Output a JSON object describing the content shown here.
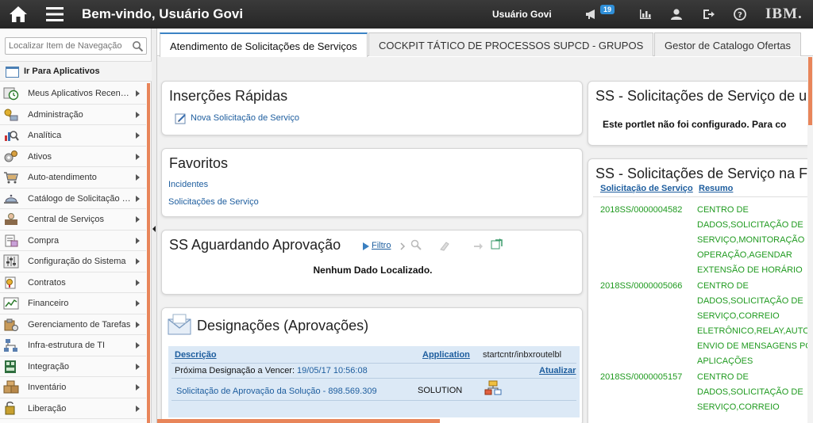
{
  "topbar": {
    "welcome": "Bem-vindo, Usuário Govi",
    "user": "Usuário Govi",
    "notifications_count": "19",
    "brand": "IBM.",
    "icons": [
      "home-icon",
      "menu-icon",
      "megaphone-icon",
      "bar-chart-icon",
      "user-icon",
      "logout-icon",
      "help-icon"
    ]
  },
  "sidebar": {
    "search_placeholder": "Localizar Item de Navegação",
    "goto_label": "Ir Para Aplicativos",
    "items": [
      {
        "label": "Meus Aplicativos Recen…",
        "icon": "clock-icon"
      },
      {
        "label": "Administração",
        "icon": "key-icon"
      },
      {
        "label": "Analítica",
        "icon": "analytics-icon"
      },
      {
        "label": "Ativos",
        "icon": "gears-icon"
      },
      {
        "label": "Auto-atendimento",
        "icon": "cart-icon"
      },
      {
        "label": "Catálogo de Solicitação …",
        "icon": "service-bell-icon"
      },
      {
        "label": "Central de Serviços",
        "icon": "helpdesk-icon"
      },
      {
        "label": "Compra",
        "icon": "purchase-icon"
      },
      {
        "label": "Configuração do Sistema",
        "icon": "sliders-icon"
      },
      {
        "label": "Contratos",
        "icon": "contract-icon"
      },
      {
        "label": "Financeiro",
        "icon": "finance-chart-icon"
      },
      {
        "label": "Gerenciamento de Tarefas",
        "icon": "task-icon"
      },
      {
        "label": "Infra-estrutura de TI",
        "icon": "network-icon"
      },
      {
        "label": "Integração",
        "icon": "integration-icon"
      },
      {
        "label": "Inventário",
        "icon": "inventory-icon"
      },
      {
        "label": "Liberação",
        "icon": "release-icon"
      }
    ]
  },
  "tabs": [
    {
      "label": "Atendimento de Solicitações de Serviços",
      "active": true
    },
    {
      "label": "COCKPIT TÁTICO DE PROCESSOS SUPCD - GRUPOS",
      "active": false
    },
    {
      "label": "Gestor de Catalogo Ofertas",
      "active": false
    }
  ],
  "insercoes": {
    "title": "Inserções Rápidas",
    "link": "Nova Solicitação de Serviço"
  },
  "favoritos": {
    "title": "Favoritos",
    "links": [
      "Incidentes",
      "Solicitações de Serviço"
    ]
  },
  "aguardando": {
    "title": "SS Aguardando Aprovação",
    "filter_label": "Filtro",
    "empty_message": "Nenhum Dado Localizado."
  },
  "designacoes": {
    "title": "Designações (Aprovações)",
    "col_description": "Descrição",
    "col_application": "Application",
    "col_route": "startcntr/inbxroutelbl",
    "next_label": "Próxima Designação a Vencer:",
    "next_date": "19/05/17 10:56:08",
    "refresh_label": "Atualizar",
    "row_description": "Solicitação de Aprovação da Solução - 898.569.309",
    "row_application": "SOLUTION"
  },
  "ss_unconfigured": {
    "title": "SS - Solicitações de Serviço de u",
    "message": "Este portlet não foi configurado. Para co"
  },
  "ss_list": {
    "title": "SS - Solicitações de Serviço na F",
    "col_id": "Solicitação de Serviço",
    "col_summary": "Resumo",
    "rows": [
      {
        "id": "2018SS/0000004582",
        "summary_lines": [
          "CENTRO DE",
          "DADOS,SOLICITAÇÃO DE",
          "SERVIÇO,MONITORAÇÃO",
          "OPERAÇÃO,AGENDAR",
          "EXTENSÃO DE HORÁRIO"
        ]
      },
      {
        "id": "2018SS/0000005066",
        "summary_lines": [
          "CENTRO DE",
          "DADOS,SOLICITAÇÃO DE",
          "SERVIÇO,CORREIO",
          "ELETRÔNICO,RELAY,AUTO",
          "ENVIO DE MENSAGENS PO",
          "APLICAÇÕES"
        ]
      },
      {
        "id": "2018SS/0000005157",
        "summary_lines": [
          "CENTRO DE",
          "DADOS,SOLICITAÇÃO DE",
          "SERVIÇO,CORREIO"
        ]
      }
    ]
  }
}
